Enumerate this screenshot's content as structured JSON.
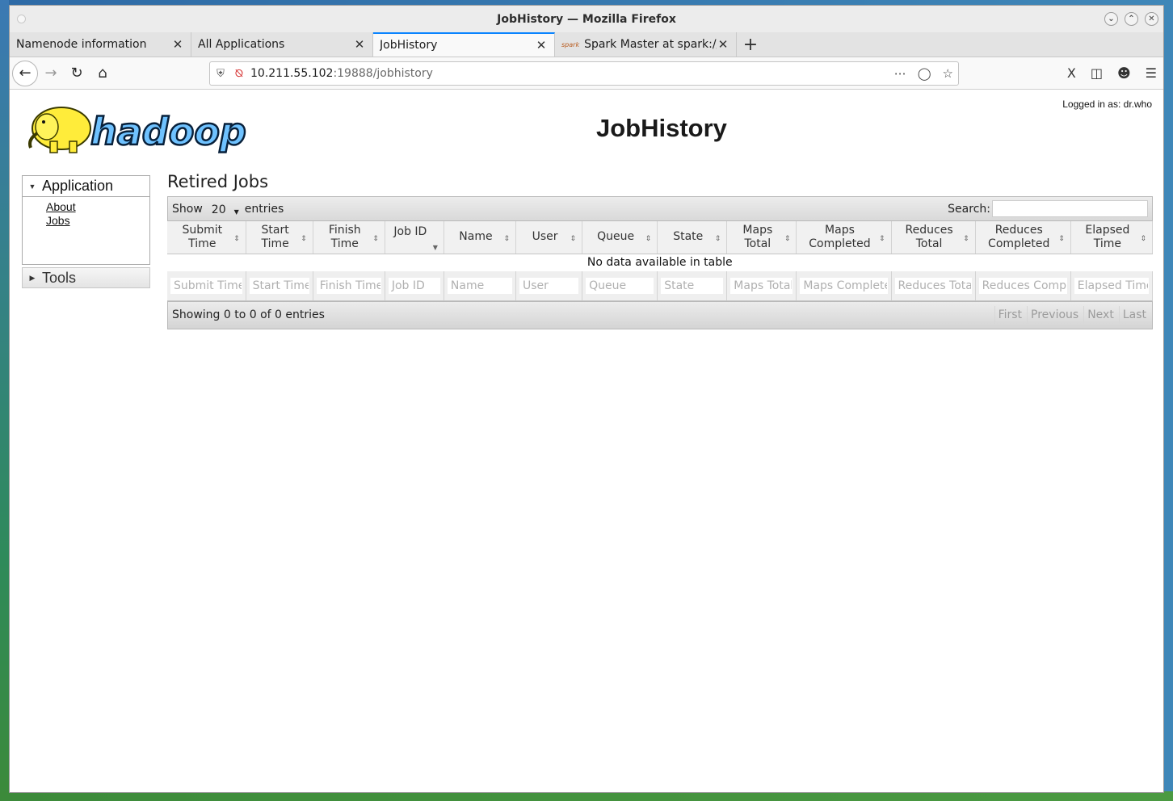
{
  "window": {
    "title": "JobHistory — Mozilla Firefox"
  },
  "tabs": [
    {
      "label": "Namenode information",
      "active": false
    },
    {
      "label": "All Applications",
      "active": false
    },
    {
      "label": "JobHistory",
      "active": true
    },
    {
      "label": "Spark Master at spark://",
      "active": false,
      "favicon_text": "spark"
    }
  ],
  "url": {
    "host": "10.211.55.102",
    "path": ":19888/jobhistory"
  },
  "page": {
    "logged_in": "Logged in as: dr.who",
    "title": "JobHistory",
    "logo_text": "hadoop"
  },
  "sidebar": {
    "application_label": "Application",
    "links": [
      "About",
      "Jobs"
    ],
    "tools_label": "Tools"
  },
  "table": {
    "section_title": "Retired Jobs",
    "show_label": "Show",
    "show_value": "20",
    "entries_label": "entries",
    "search_label": "Search:",
    "columns": [
      "Submit\nTime",
      "Start\nTime",
      "Finish\nTime",
      "Job ID",
      "Name",
      "User",
      "Queue",
      "State",
      "Maps\nTotal",
      "Maps\nCompleted",
      "Reduces\nTotal",
      "Reduces\nCompleted",
      "Elapsed\nTime"
    ],
    "filters": [
      "Submit Time",
      "Start Time",
      "Finish Time",
      "Job ID",
      "Name",
      "User",
      "Queue",
      "State",
      "Maps Total",
      "Maps Completed",
      "Reduces Total",
      "Reduces Completed",
      "Elapsed Time"
    ],
    "empty_message": "No data available in table",
    "info": "Showing 0 to 0 of 0 entries",
    "pager": [
      "First",
      "Previous",
      "Next",
      "Last"
    ]
  }
}
